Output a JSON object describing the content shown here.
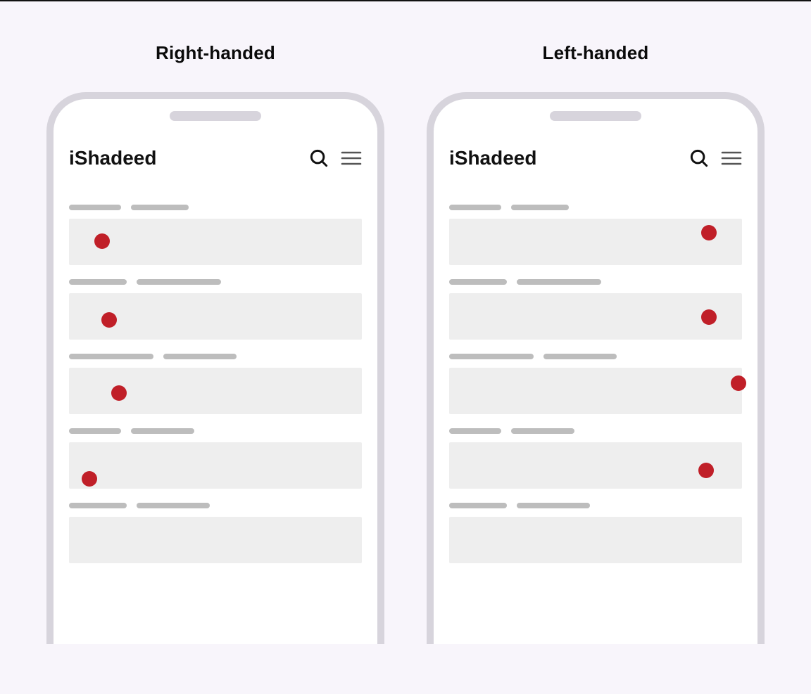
{
  "titles": {
    "right": "Right-handed",
    "left": "Left-handed"
  },
  "brand": "iShadeed",
  "icons": {
    "search": "search-icon",
    "menu": "hamburger-menu-icon"
  },
  "colors": {
    "dot": "#c01f28",
    "frame": "#d7d4dc",
    "bg": "#f8f5fb",
    "card": "#eeeeee",
    "bar": "#bdbdbd"
  }
}
